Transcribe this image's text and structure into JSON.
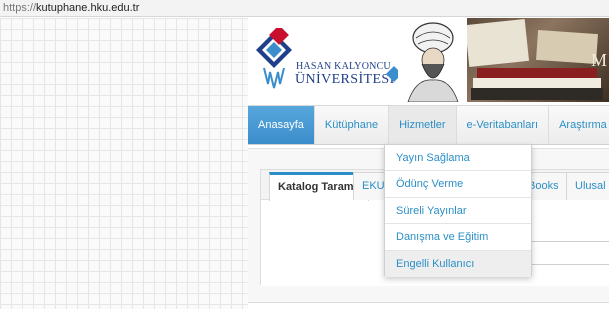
{
  "browser": {
    "url_protocol": "https://",
    "url_host": "kutuphane.hku.edu.tr"
  },
  "header": {
    "logo_line1": "HASAN KALYONCU",
    "logo_line2": "ÜNİVERSİTESİ",
    "banner_letter": "M"
  },
  "nav": {
    "items": [
      {
        "label": "Anasayfa"
      },
      {
        "label": "Kütüphane"
      },
      {
        "label": "Hizmetler"
      },
      {
        "label": "e-Veritabanları"
      },
      {
        "label": "Araştırma"
      }
    ]
  },
  "tabs": {
    "items": [
      {
        "label": "Katalog Tarama"
      },
      {
        "label": "EKUA"
      },
      {
        "label": "Books"
      },
      {
        "label": "Ulusal K"
      }
    ]
  },
  "dropdown": {
    "items": [
      {
        "label": "Yayın Sağlama"
      },
      {
        "label": "Ödünç Verme"
      },
      {
        "label": "Süreli Yayınlar"
      },
      {
        "label": "Danışma ve Eğitim"
      },
      {
        "label": "Engelli Kullanıcı"
      }
    ]
  },
  "colors": {
    "accent": "#2b8fc6",
    "active_nav": "#3b8dcb",
    "logo_blue": "#1f3f8a",
    "logo_red": "#c8102e"
  }
}
